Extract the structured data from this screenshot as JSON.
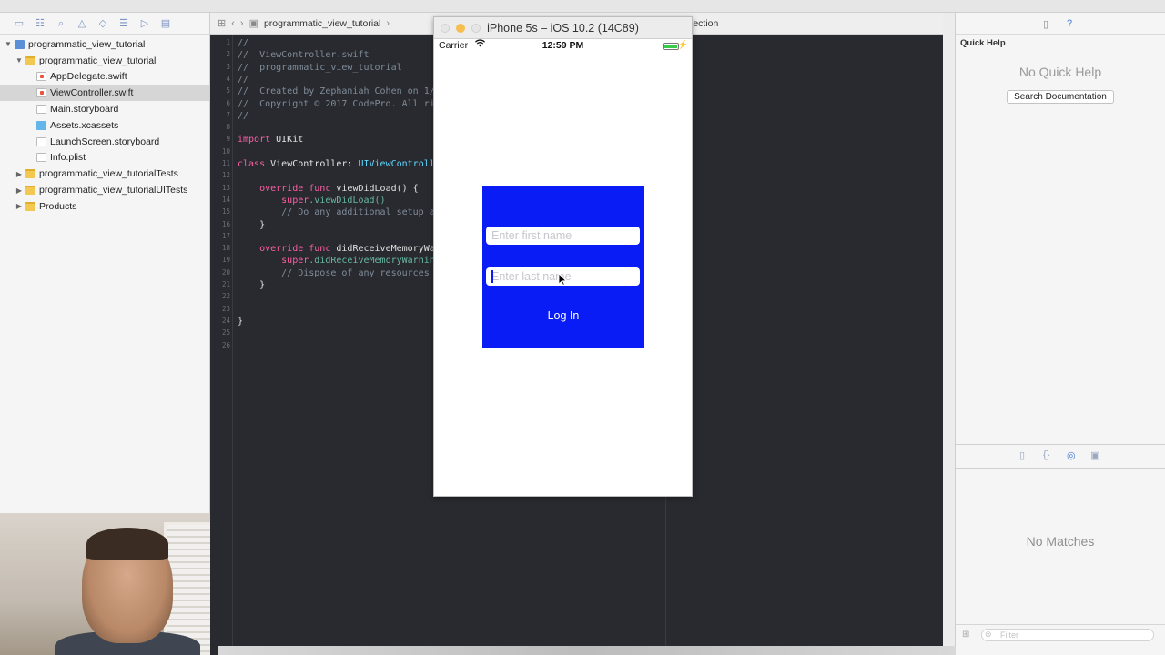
{
  "navigator": {
    "tree": [
      {
        "label": "programmatic_view_tutorial",
        "indent": 0,
        "disclosure": "▼",
        "icon": "project"
      },
      {
        "label": "programmatic_view_tutorial",
        "indent": 1,
        "disclosure": "▼",
        "icon": "folder"
      },
      {
        "label": "AppDelegate.swift",
        "indent": 2,
        "disclosure": "",
        "icon": "swift"
      },
      {
        "label": "ViewController.swift",
        "indent": 2,
        "disclosure": "",
        "icon": "swift",
        "selected": true
      },
      {
        "label": "Main.storyboard",
        "indent": 2,
        "disclosure": "",
        "icon": "sb"
      },
      {
        "label": "Assets.xcassets",
        "indent": 2,
        "disclosure": "",
        "icon": "assets"
      },
      {
        "label": "LaunchScreen.storyboard",
        "indent": 2,
        "disclosure": "",
        "icon": "sb"
      },
      {
        "label": "Info.plist",
        "indent": 2,
        "disclosure": "",
        "icon": "plist"
      },
      {
        "label": "programmatic_view_tutorialTests",
        "indent": 1,
        "disclosure": "▶",
        "icon": "folder"
      },
      {
        "label": "programmatic_view_tutorialUITests",
        "indent": 1,
        "disclosure": "▶",
        "icon": "folder"
      },
      {
        "label": "Products",
        "indent": 1,
        "disclosure": "▶",
        "icon": "folder"
      }
    ]
  },
  "editor": {
    "jumpbar": {
      "project": "programmatic_view_tutorial",
      "tail": "lection"
    },
    "lines": [
      {
        "n": "1",
        "parts": [
          {
            "t": "//",
            "c": "comment"
          }
        ]
      },
      {
        "n": "2",
        "parts": [
          {
            "t": "//  ViewController.swift",
            "c": "comment"
          }
        ]
      },
      {
        "n": "3",
        "parts": [
          {
            "t": "//  programmatic_view_tutorial",
            "c": "comment"
          }
        ]
      },
      {
        "n": "4",
        "parts": [
          {
            "t": "//",
            "c": "comment"
          }
        ]
      },
      {
        "n": "5",
        "parts": [
          {
            "t": "//  Created by Zephaniah Cohen on 1/",
            "c": "comment"
          }
        ]
      },
      {
        "n": "6",
        "parts": [
          {
            "t": "//  Copyright © 2017 CodePro. All ri",
            "c": "comment"
          }
        ]
      },
      {
        "n": "7",
        "parts": [
          {
            "t": "//",
            "c": "comment"
          }
        ]
      },
      {
        "n": "8",
        "parts": []
      },
      {
        "n": "9",
        "parts": [
          {
            "t": "import",
            "c": "kw"
          },
          {
            "t": " UIKit",
            "c": "plain"
          }
        ]
      },
      {
        "n": "10",
        "parts": []
      },
      {
        "n": "11",
        "parts": [
          {
            "t": "class",
            "c": "kw"
          },
          {
            "t": " ViewController: ",
            "c": "plain"
          },
          {
            "t": "UIViewControlle",
            "c": "type"
          }
        ]
      },
      {
        "n": "12",
        "parts": []
      },
      {
        "n": "13",
        "parts": [
          {
            "t": "    override func",
            "c": "kw"
          },
          {
            "t": " viewDidLoad() {",
            "c": "plain"
          }
        ]
      },
      {
        "n": "14",
        "parts": [
          {
            "t": "        super",
            "c": "kw"
          },
          {
            "t": ".viewDidLoad()",
            "c": "fn"
          }
        ]
      },
      {
        "n": "15",
        "parts": [
          {
            "t": "        // Do any additional setup af",
            "c": "comment"
          }
        ]
      },
      {
        "n": "16",
        "parts": [
          {
            "t": "    }",
            "c": "plain"
          }
        ]
      },
      {
        "n": "17",
        "parts": []
      },
      {
        "n": "18",
        "parts": [
          {
            "t": "    override func",
            "c": "kw"
          },
          {
            "t": " didReceiveMemoryWar",
            "c": "plain"
          }
        ]
      },
      {
        "n": "19",
        "parts": [
          {
            "t": "        super",
            "c": "kw"
          },
          {
            "t": ".didReceiveMemoryWarning",
            "c": "fn"
          }
        ]
      },
      {
        "n": "20",
        "parts": [
          {
            "t": "        // Dispose of any resources t",
            "c": "comment"
          }
        ]
      },
      {
        "n": "21",
        "parts": [
          {
            "t": "    }",
            "c": "plain"
          }
        ]
      },
      {
        "n": "22",
        "parts": []
      },
      {
        "n": "23",
        "parts": []
      },
      {
        "n": "24",
        "parts": [
          {
            "t": "}",
            "c": "plain"
          }
        ]
      },
      {
        "n": "25",
        "parts": []
      },
      {
        "n": "26",
        "parts": []
      }
    ]
  },
  "simulator": {
    "title": "iPhone 5s – iOS 10.2 (14C89)",
    "status": {
      "carrier": "Carrier",
      "time": "12:59 PM",
      "battery_level": 1.0
    },
    "login": {
      "first_placeholder": "Enter first name",
      "last_placeholder": "Enter last name",
      "button_label": "Log In",
      "box_color": "#0a1cf5"
    }
  },
  "inspector": {
    "header": "Quick Help",
    "no_help": "No Quick Help",
    "search_button": "Search Documentation",
    "no_matches": "No Matches",
    "filter_placeholder": "Filter"
  }
}
